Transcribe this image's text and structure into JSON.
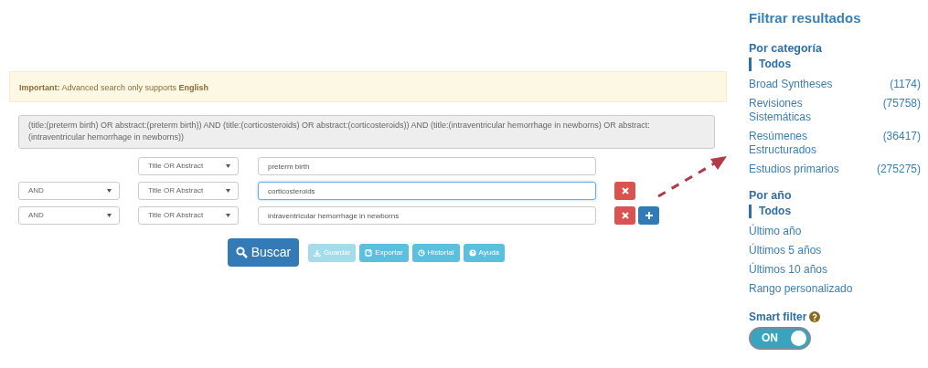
{
  "alert": {
    "text": "**Important:** Advanced search only supports **English**"
  },
  "query": "(title:(preterm birth) OR abstract:(preterm birth)) AND (title:(corticosteroids) OR abstract:(corticosteroids)) AND (title:(intraventricular hemorrhage in newborns) OR abstract:(intraventricular hemorrhage in newborns))",
  "rows": [
    {
      "operator": null,
      "field": "Title OR Abstract",
      "value": "preterm birth",
      "focused": false,
      "actions": []
    },
    {
      "operator": "AND",
      "field": "Title OR Abstract",
      "value": "corticosteroids",
      "focused": true,
      "actions": [
        {
          "kind": "remove"
        }
      ]
    },
    {
      "operator": "AND",
      "field": "Title OR Abstract",
      "value": "intraventricular hemorrhage in newborns",
      "focused": false,
      "actions": [
        {
          "kind": "remove"
        },
        {
          "kind": "add"
        }
      ]
    }
  ],
  "search_button": {
    "label": "Buscar"
  },
  "tools": [
    {
      "kind": "save",
      "label": "Guardar",
      "disabled": true
    },
    {
      "kind": "export",
      "label": "Exportar",
      "disabled": false
    },
    {
      "kind": "history",
      "label": "Historial",
      "disabled": false
    },
    {
      "kind": "help",
      "label": "Ayuda",
      "disabled": false
    }
  ],
  "sidebar": {
    "title": "Filtrar resultados",
    "sections": [
      {
        "heading": "Por categoría",
        "items": [
          {
            "label": "Todos",
            "selected": true
          },
          {
            "label": "Broad Syntheses",
            "count": "(1174)",
            "selected": false
          },
          {
            "label": "Revisiones Sistemáticas",
            "count": "(75758)",
            "selected": false
          },
          {
            "label": "Resúmenes Estructurados",
            "count": "(36417)",
            "selected": false
          },
          {
            "label": "Estudios primarios",
            "count": "(275275)",
            "selected": false
          }
        ]
      },
      {
        "heading": "Por año",
        "items": [
          {
            "label": "Todos",
            "selected": true
          },
          {
            "label": "Último año",
            "selected": false
          },
          {
            "label": "Últimos 5 años",
            "selected": false
          },
          {
            "label": "Últimos 10 años",
            "selected": false
          },
          {
            "label": "Rango personalizado",
            "selected": false
          }
        ]
      }
    ],
    "smart_filter": {
      "label": "Smart filter",
      "on": true,
      "state_label": "ON"
    }
  }
}
